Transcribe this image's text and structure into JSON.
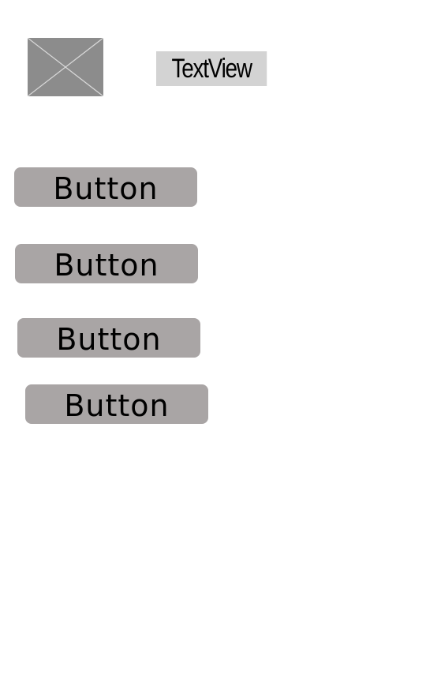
{
  "header": {
    "text_view": "TextView"
  },
  "image_placeholder": {
    "icon": "broken-image-x-icon",
    "color": "#8c8c8c"
  },
  "buttons": [
    {
      "label": "Button"
    },
    {
      "label": "Button"
    },
    {
      "label": "Button"
    },
    {
      "label": "Button"
    }
  ],
  "colors": {
    "button_bg": "#a9a5a5",
    "text_view_bg": "#d3d3d3",
    "page_bg": "#ffffff"
  }
}
